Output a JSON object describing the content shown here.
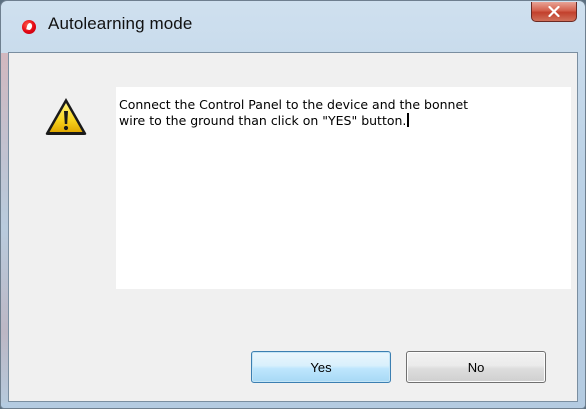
{
  "window": {
    "title": "Autolearning mode",
    "app_icon": "vodafone-logo-icon",
    "close_icon": "close-icon",
    "accent_close": "#c2402c"
  },
  "dialog": {
    "icon": "warning-icon",
    "message": "Connect the Control Panel to the device and the bonnet\nwire to the ground than click on \"YES\" button.",
    "yes_label": "Yes",
    "no_label": "No"
  }
}
